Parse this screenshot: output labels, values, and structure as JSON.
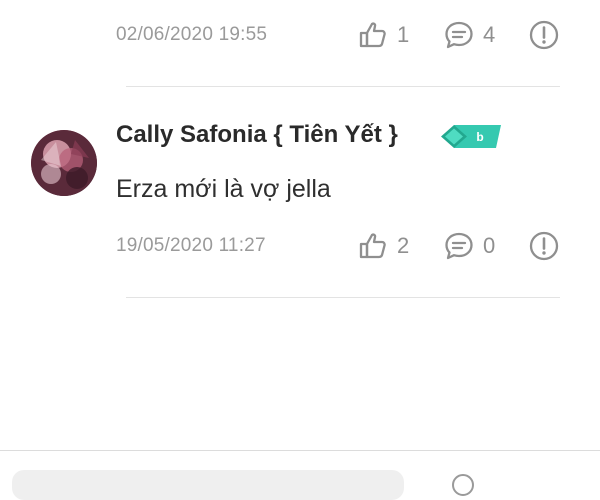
{
  "comments": [
    {
      "timestamp": "02/06/2020 19:55",
      "likes": "1",
      "replies": "4"
    },
    {
      "author": "Cally Safonia { Tiên Yết }",
      "badge_label": "b",
      "badge_colors": {
        "primary": "#2ec4a6",
        "secondary": "#1f9e86"
      },
      "text": "Erza mới là vợ jella",
      "timestamp": "19/05/2020 11:27",
      "likes": "2",
      "replies": "0"
    }
  ],
  "icons": {
    "like": "thumbs-up-icon",
    "reply": "chat-bubble-icon",
    "report": "exclamation-circle-icon"
  }
}
